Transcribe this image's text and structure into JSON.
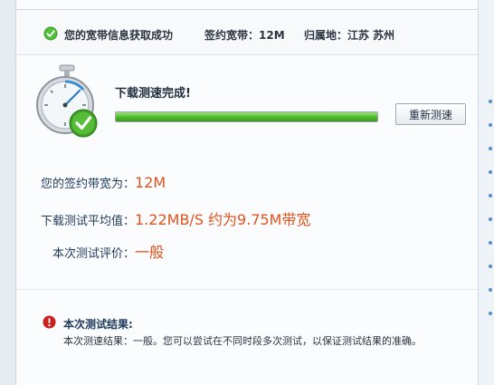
{
  "header": {
    "status": "您的宽带信息获取成功",
    "bandwidth": "签约宽带：12M",
    "region": "归属地：江苏  苏州"
  },
  "test": {
    "complete_title": "下载测速完成!",
    "progress_fraction": 1.0,
    "retest_label": "重新测速"
  },
  "results": {
    "contracted_label": "您的签约带宽为：",
    "contracted_value": "12M",
    "average_label": "下载测试平均值：",
    "average_value": "1.22MB/S 约为9.75M带宽",
    "rating_label": "本次测试评价：",
    "rating_value": "一般"
  },
  "summary": {
    "title": "本次测试结果:",
    "text": "本次测速结果：一般。您可以尝试在不同时段多次测试，以保证测试结果的准确。"
  },
  "colors": {
    "accent_value": "#e0531e",
    "progress_green": "#4fb82b",
    "error_red": "#cc1f1f"
  },
  "icons": [
    "check-icon",
    "stopwatch-icon",
    "alert-icon"
  ]
}
